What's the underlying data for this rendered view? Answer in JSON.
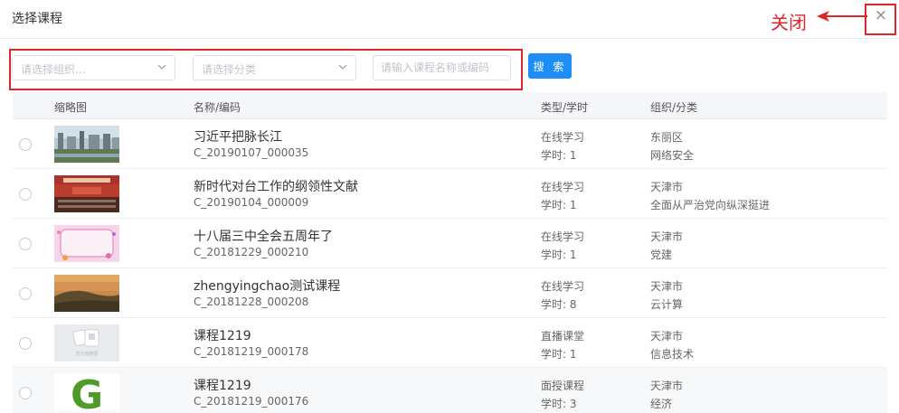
{
  "dialog": {
    "title": "选择课程",
    "close_symbol": "×"
  },
  "annotation": {
    "close_label": "关闭",
    "color": "#e0262d"
  },
  "filters": {
    "org_placeholder": "请选择组织...",
    "category_placeholder": "请选择分类",
    "keyword_placeholder": "请输入课程名称或编码",
    "search_label": "搜 索"
  },
  "table": {
    "headers": {
      "thumb": "缩略图",
      "name": "名称/编码",
      "type": "类型/学时",
      "org": "组织/分类"
    },
    "rows": [
      {
        "name": "习近平把脉长江",
        "code": "C_20190107_000035",
        "type": "在线学习",
        "hours": "学时: 1",
        "org": "东丽区",
        "category": "网络安全",
        "thumb": "city-photo"
      },
      {
        "name": "新时代对台工作的纲领性文献",
        "code": "C_20190104_000009",
        "type": "在线学习",
        "hours": "学时: 1",
        "org": "天津市",
        "category": "全面从严治党向纵深挺进",
        "thumb": "hall-photo"
      },
      {
        "name": "十八届三中全会五周年了",
        "code": "C_20181229_000210",
        "type": "在线学习",
        "hours": "学时: 1",
        "org": "天津市",
        "category": "党建",
        "thumb": "pink-frame"
      },
      {
        "name": "zhengyingchao测试课程",
        "code": "C_20181228_000208",
        "type": "在线学习",
        "hours": "学时: 8",
        "org": "天津市",
        "category": "云计算",
        "thumb": "sunset-hill"
      },
      {
        "name": "课程1219",
        "code": "C_20181219_000178",
        "type": "直播课堂",
        "hours": "学时: 1",
        "org": "天津市",
        "category": "信息技术",
        "thumb": "placeholder-image",
        "thumb_text": "暂无缩略图"
      },
      {
        "name": "课程1219",
        "code": "C_20181219_000176",
        "type": "面授课程",
        "hours": "学时: 3",
        "org": "天津市",
        "category": "经济",
        "thumb": "green-letter-g",
        "thumb_text": "G"
      }
    ]
  },
  "colors": {
    "accent": "#1d8ef6",
    "highlight": "#e0262d"
  }
}
